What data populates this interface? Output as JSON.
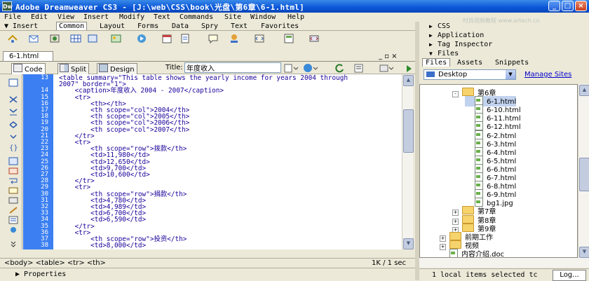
{
  "window": {
    "title": "Adobe Dreamweaver CS3 - [J:\\web\\CSS\\book\\光盘\\第6章\\6-1.html]",
    "logo": "Dw"
  },
  "menu": [
    "File",
    "Edit",
    "View",
    "Insert",
    "Modify",
    "Text",
    "Commands",
    "Site",
    "Window",
    "Help"
  ],
  "insert_bar": {
    "label": "▼ Insert",
    "tabs": [
      "Common",
      "Layout",
      "Forms",
      "Data",
      "Spry",
      "Text",
      "Favorites"
    ],
    "active": "Common"
  },
  "document": {
    "tab": "6-1.html",
    "views": [
      "Code",
      "Split",
      "Design"
    ],
    "title_label": "Title:",
    "title_value": "年度收入"
  },
  "code_lines": [
    {
      "n": "13",
      "t": "<table summary=\"This table shows the yearly income for years 2004 through"
    },
    {
      "n": "",
      "t": "2007\" border=\"1\">"
    },
    {
      "n": "14",
      "t": "    <caption>年度收入 2004 - 2007</caption>"
    },
    {
      "n": "15",
      "t": "    <tr>"
    },
    {
      "n": "16",
      "t": "        <th></th>"
    },
    {
      "n": "17",
      "t": "        <th scope=\"col\">2004</th>"
    },
    {
      "n": "18",
      "t": "        <th scope=\"col\">2005</th>"
    },
    {
      "n": "19",
      "t": "        <th scope=\"col\">2006</th>"
    },
    {
      "n": "20",
      "t": "        <th scope=\"col\">2007</th>"
    },
    {
      "n": "21",
      "t": "    </tr>"
    },
    {
      "n": "22",
      "t": "    <tr>"
    },
    {
      "n": "23",
      "t": "        <th scope=\"row\">拨款</th>"
    },
    {
      "n": "24",
      "t": "        <td>11,980</td>"
    },
    {
      "n": "25",
      "t": "        <td>12,650</td>"
    },
    {
      "n": "26",
      "t": "        <td>9,700</td>"
    },
    {
      "n": "27",
      "t": "        <td>10,600</td>"
    },
    {
      "n": "28",
      "t": "    </tr>"
    },
    {
      "n": "29",
      "t": "    <tr>"
    },
    {
      "n": "30",
      "t": "        <th scope=\"row\">捐款</th>"
    },
    {
      "n": "31",
      "t": "        <td>4,780</td>"
    },
    {
      "n": "32",
      "t": "        <td>4,989</td>"
    },
    {
      "n": "33",
      "t": "        <td>6,700</td>"
    },
    {
      "n": "34",
      "t": "        <td>6,590</td>"
    },
    {
      "n": "35",
      "t": "    </tr>"
    },
    {
      "n": "36",
      "t": "    <tr>"
    },
    {
      "n": "37",
      "t": "        <th scope=\"row\">投资</th>"
    },
    {
      "n": "38",
      "t": "        <td>8,000</td>"
    }
  ],
  "status": {
    "tag_selector": "<body> <table> <tr> <th>",
    "info": "1K / 1 sec"
  },
  "properties": {
    "label": "▶ Properties"
  },
  "panels": {
    "css": "CSS",
    "application": "Application",
    "tag_inspector": "Tag Inspector",
    "files": "Files",
    "watermark": "时尚视频教程 www.artech.cn"
  },
  "files_panel": {
    "tabs": [
      "Files",
      "Assets",
      "Snippets"
    ],
    "site": "Desktop",
    "manage_link": "Manage Sites",
    "status": "1 local items selected tc",
    "log_button": "Log..."
  },
  "tree": [
    {
      "label": "第6章",
      "type": "folder",
      "indent": 2,
      "ex": "-"
    },
    {
      "label": "6-1.html",
      "type": "file",
      "indent": 3,
      "sel": true
    },
    {
      "label": "6-10.html",
      "type": "file",
      "indent": 3
    },
    {
      "label": "6-11.html",
      "type": "file",
      "indent": 3
    },
    {
      "label": "6-12.html",
      "type": "file",
      "indent": 3
    },
    {
      "label": "6-2.html",
      "type": "file",
      "indent": 3
    },
    {
      "label": "6-3.html",
      "type": "file",
      "indent": 3
    },
    {
      "label": "6-4.html",
      "type": "file",
      "indent": 3
    },
    {
      "label": "6-5.html",
      "type": "file",
      "indent": 3
    },
    {
      "label": "6-6.html",
      "type": "file",
      "indent": 3
    },
    {
      "label": "6-7.html",
      "type": "file",
      "indent": 3
    },
    {
      "label": "6-8.html",
      "type": "file",
      "indent": 3
    },
    {
      "label": "6-9.html",
      "type": "file",
      "indent": 3
    },
    {
      "label": "bg1.jpg",
      "type": "file",
      "indent": 3
    },
    {
      "label": "第7章",
      "type": "folder",
      "indent": 2,
      "ex": "+"
    },
    {
      "label": "第8章",
      "type": "folder",
      "indent": 2,
      "ex": "+"
    },
    {
      "label": "第9章",
      "type": "folder",
      "indent": 2,
      "ex": "+"
    },
    {
      "label": "前期工作",
      "type": "folder",
      "indent": 1,
      "ex": "+"
    },
    {
      "label": "视频",
      "type": "folder",
      "indent": 1,
      "ex": "+"
    },
    {
      "label": "内容介绍.doc",
      "type": "file",
      "indent": 1
    }
  ]
}
